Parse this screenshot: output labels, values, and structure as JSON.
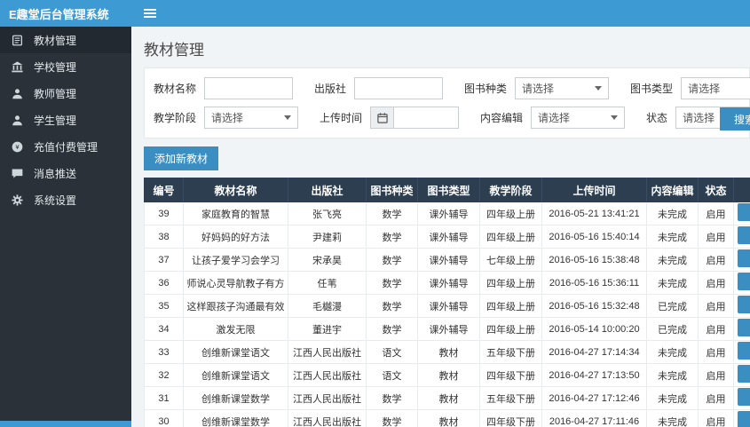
{
  "app": {
    "title": "E趣堂后台管理系统"
  },
  "sidebar": {
    "items": [
      {
        "label": "教材管理",
        "icon": "book-icon",
        "active": true
      },
      {
        "label": "学校管理",
        "icon": "school-icon",
        "active": false
      },
      {
        "label": "教师管理",
        "icon": "teacher-icon",
        "active": false
      },
      {
        "label": "学生管理",
        "icon": "student-icon",
        "active": false
      },
      {
        "label": "充值付费管理",
        "icon": "payment-icon",
        "active": false
      },
      {
        "label": "消息推送",
        "icon": "message-icon",
        "active": false
      },
      {
        "label": "系统设置",
        "icon": "settings-icon",
        "active": false
      }
    ]
  },
  "page": {
    "title": "教材管理"
  },
  "filters": {
    "row1": [
      {
        "key": "material-name",
        "label": "教材名称",
        "type": "input",
        "value": ""
      },
      {
        "key": "publisher",
        "label": "出版社",
        "type": "input",
        "value": ""
      },
      {
        "key": "book-kind",
        "label": "图书种类",
        "type": "select",
        "value": "请选择"
      },
      {
        "key": "book-type",
        "label": "图书类型",
        "type": "select",
        "value": "请选择"
      }
    ],
    "row2": [
      {
        "key": "teaching-stage",
        "label": "教学阶段",
        "type": "select",
        "value": "请选择"
      },
      {
        "key": "upload-time",
        "label": "上传时间",
        "type": "date",
        "value": ""
      },
      {
        "key": "content-editor",
        "label": "内容编辑",
        "type": "select",
        "value": "请选择"
      },
      {
        "key": "status",
        "label": "状态",
        "type": "select",
        "value": "请选择"
      }
    ],
    "search_label": "搜索"
  },
  "toolbar": {
    "add_label": "添加新教材"
  },
  "table": {
    "headers": [
      "编号",
      "教材名称",
      "出版社",
      "图书种类",
      "图书类型",
      "教学阶段",
      "上传时间",
      "内容编辑",
      "状态"
    ],
    "rows": [
      [
        "39",
        "家庭教育的智慧",
        "张飞亮",
        "数学",
        "课外辅导",
        "四年级上册",
        "2016-05-21 13:41:21",
        "未完成",
        "启用"
      ],
      [
        "38",
        "好妈妈的好方法",
        "尹建莉",
        "数学",
        "课外辅导",
        "四年级上册",
        "2016-05-16 15:40:14",
        "未完成",
        "启用"
      ],
      [
        "37",
        "让孩子爱学习会学习",
        "宋承昊",
        "数学",
        "课外辅导",
        "七年级上册",
        "2016-05-16 15:38:48",
        "未完成",
        "启用"
      ],
      [
        "36",
        "师说心灵导航教子有方",
        "任苇",
        "数学",
        "课外辅导",
        "四年级上册",
        "2016-05-16 15:36:11",
        "未完成",
        "启用"
      ],
      [
        "35",
        "这样跟孩子沟通最有效",
        "毛樾漫",
        "数学",
        "课外辅导",
        "四年级上册",
        "2016-05-16 15:32:48",
        "已完成",
        "启用"
      ],
      [
        "34",
        "激发无限",
        "董进宇",
        "数学",
        "课外辅导",
        "四年级上册",
        "2016-05-14 10:00:20",
        "已完成",
        "启用"
      ],
      [
        "33",
        "创维新课堂语文",
        "江西人民出版社",
        "语文",
        "教材",
        "五年级下册",
        "2016-04-27 17:14:34",
        "未完成",
        "启用"
      ],
      [
        "32",
        "创维新课堂语文",
        "江西人民出版社",
        "语文",
        "教材",
        "四年级下册",
        "2016-04-27 17:13:50",
        "未完成",
        "启用"
      ],
      [
        "31",
        "创维新课堂数学",
        "江西人民出版社",
        "数学",
        "教材",
        "五年级下册",
        "2016-04-27 17:12:46",
        "未完成",
        "启用"
      ],
      [
        "30",
        "创维新课堂数学",
        "江西人民出版社",
        "数学",
        "教材",
        "四年级下册",
        "2016-04-27 17:11:46",
        "未完成",
        "启用"
      ]
    ]
  }
}
